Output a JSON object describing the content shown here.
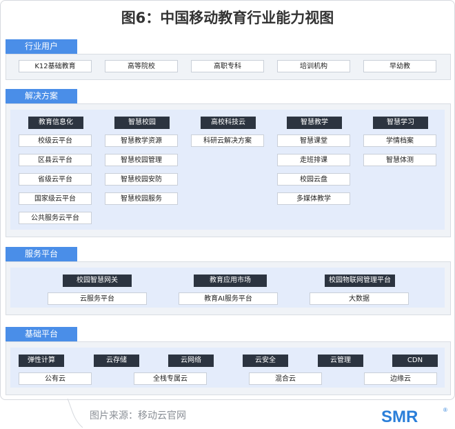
{
  "title": "图6：中国移动教育行业能力视图",
  "sections": {
    "users": {
      "header": "行业用户",
      "items": [
        "K12基础教育",
        "高等院校",
        "高职专科",
        "培训机构",
        "早幼教"
      ]
    },
    "solutions": {
      "header": "解决方案",
      "columns": [
        {
          "title": "教育信息化",
          "items": [
            "校级云平台",
            "区县云平台",
            "省级云平台",
            "国家级云平台",
            "公共服务云平台"
          ]
        },
        {
          "title": "智慧校园",
          "items": [
            "智慧教学资源",
            "智慧校园管理",
            "智慧校园安防",
            "智慧校园服务"
          ]
        },
        {
          "title": "高校科技云",
          "items": [
            "科研云解决方案"
          ]
        },
        {
          "title": "智慧教学",
          "items": [
            "智慧课堂",
            "走班排课",
            "校园云盘",
            "多媒体教学"
          ]
        },
        {
          "title": "智慧学习",
          "items": [
            "学情档案",
            "智慧体测"
          ]
        }
      ]
    },
    "service": {
      "header": "服务平台",
      "top": [
        "校园智慧网关",
        "教育应用市场",
        "校园物联网管理平台"
      ],
      "bottom": [
        "云服务平台",
        "教育AI服务平台",
        "大数据"
      ]
    },
    "base": {
      "header": "基础平台",
      "top": [
        "弹性计算",
        "云存储",
        "云网络",
        "云安全",
        "云管理",
        "CDN"
      ],
      "bottom": [
        "公有云",
        "全栈专属云",
        "混合云",
        "边缘云"
      ]
    }
  },
  "footer": {
    "source": "图片来源：移动云官网",
    "logo_text": "SMR",
    "logo_mark": "®"
  },
  "colors": {
    "header_blue": "#4a8ee8",
    "dark_box": "#2c3440",
    "inner_panel": "#e4ecfb",
    "logo_blue": "#2b7fd9"
  }
}
